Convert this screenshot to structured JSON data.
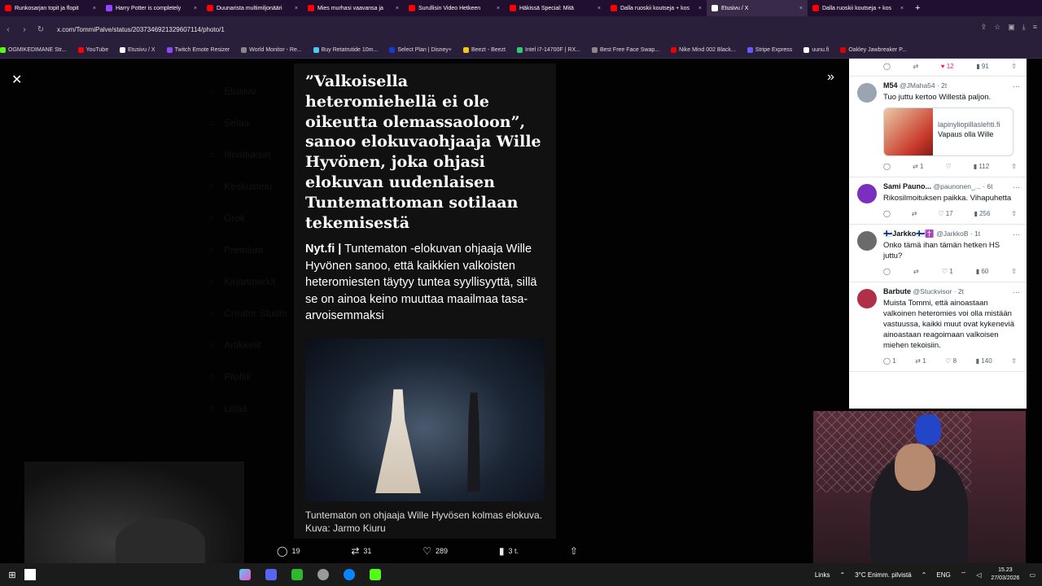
{
  "colors": {
    "brand": "#1d9bf0",
    "tabbar": "#200f2e",
    "toolbar": "#2a1f3a",
    "like": "#f91880"
  },
  "tabs": [
    {
      "label": "Runkosarjan topit ja flopit",
      "icon": "yt-icon",
      "color": "#ff0000"
    },
    {
      "label": "Harry Potter is completely",
      "icon": "twitch-icon",
      "color": "#9146ff"
    },
    {
      "label": "Duunarista multimiljonääri",
      "icon": "yt-icon",
      "color": "#ff0000"
    },
    {
      "label": "Mies murhasi vaavansa ja",
      "icon": "yt-icon",
      "color": "#ff0000"
    },
    {
      "label": "Surullisin Video Hetkeen",
      "icon": "yt-icon",
      "color": "#ff0000"
    },
    {
      "label": "Häkissä Special: Mitä",
      "icon": "audio-icon",
      "color": "#ff0000"
    },
    {
      "label": "Dalla ruoskii koutseja + kos",
      "icon": "yt-icon",
      "color": "#ff0000"
    },
    {
      "label": "Etusivu / X",
      "icon": "x-icon",
      "color": "#ffffff",
      "active": true
    },
    {
      "label": "Dalla ruoskii koutseja + kos",
      "icon": "yt-icon",
      "color": "#ff0000"
    }
  ],
  "url": "x.com/TommiPalve/status/2037346921329607114/photo/1",
  "bookmarks": [
    {
      "label": "OGMIKEDIMANE Str...",
      "color": "#53fc18"
    },
    {
      "label": "YouTube",
      "color": "#ff0000"
    },
    {
      "label": "Etusivu / X",
      "color": "#ffffff"
    },
    {
      "label": "Twitch Emote Resizer",
      "color": "#9146ff"
    },
    {
      "label": "World Monitor - Re...",
      "color": "#888888"
    },
    {
      "label": "Buy Retatrutide 10m...",
      "color": "#4cc9f0"
    },
    {
      "label": "Select Plan | Disney+",
      "color": "#113ccf"
    },
    {
      "label": "Beezt - Beezt",
      "color": "#f5c518"
    },
    {
      "label": "Intel i7-14700F | RX...",
      "color": "#2ecc71"
    },
    {
      "label": "Best Free Face Swap...",
      "color": "#888888"
    },
    {
      "label": "Nike Mind 002 Black...",
      "color": "#e00"
    },
    {
      "label": "Stripe Express",
      "color": "#635bff"
    },
    {
      "label": "uunu.fi",
      "color": "#fff"
    },
    {
      "label": "Oakley Jawbreaker P...",
      "color": "#d00"
    }
  ],
  "bg_nav": [
    "Etusivu",
    "Selaa",
    "Ilmoitukset",
    "Keskustelu",
    "Grok",
    "Premium",
    "Kirjanmerkit",
    "Creator Studio",
    "Artikkelit",
    "Profiili",
    "Lisää"
  ],
  "article": {
    "headline": "”Valkoisella heteromiehellä ei ole oikeutta olemassaoloon”, sanoo elokuvaohjaaja Wille Hyvönen, joka ohjasi elokuvan uudenlaisen Tuntemattoman sotilaan tekemisestä",
    "source": "Nyt.fi |",
    "lead": " Tuntematon -elokuvan ohjaaja Wille Hyvönen sanoo, että kaikkien valkoisten heteromiesten täytyy tuntea syyllisyyttä, sillä se on ainoa keino muuttaa maailmaa tasa-arvoisemmaksi",
    "caption": "Tuntematon on ohjaaja Wille Hyvösen kolmas elokuva. Kuva: Jarmo Kiuru"
  },
  "tweet_actions": {
    "replies": "19",
    "reposts": "31",
    "likes": "289",
    "views": "3 t."
  },
  "replies": [
    {
      "name": "M54",
      "handle": "@JMaha54 · 2t",
      "text": "Tuo juttu kertoo Willestä paljon.",
      "card_domain": "lapinyliopillaslehti.fi",
      "card_title": "Vapaus olla Wille",
      "stats": [
        "",
        "1",
        "",
        "112"
      ],
      "avatar": "#9aa5b1"
    },
    {
      "name": "Sami Pauno...",
      "handle": "@paunonen_... · 6t",
      "text": "Rikosilmoituksen paikka. Vihapuhetta",
      "stats": [
        "",
        "",
        "17",
        "256"
      ],
      "avatar": "#7b2fbe"
    },
    {
      "name": "🇫🇮Jarkko🇫🇮✝️",
      "handle": "@JarkkoB · 1t",
      "text": "Onko tämä ihan tämän hetken HS juttu?",
      "stats": [
        "",
        "",
        "1",
        "60"
      ],
      "avatar": "#6b6b6b"
    },
    {
      "name": "Barbute",
      "handle": "@Stuckvisor · 2t",
      "text": "Muista Tommi, että ainoastaan valkoinen heteromies voi olla mistään vastuussa, kaikki muut ovat kykeneviä ainoastaan reagoimaan valkoisen miehen tekoisiin.",
      "stats": [
        "1",
        "1",
        "8",
        "140"
      ],
      "avatar": "#b0304a"
    }
  ],
  "top_stats": {
    "likes": "12",
    "views": "91"
  },
  "taskbar": {
    "links": "Links",
    "weather": "3°C  Enimm. pilvistä",
    "lang": "ENG",
    "time": "15.23",
    "date": "27/03/2026"
  }
}
